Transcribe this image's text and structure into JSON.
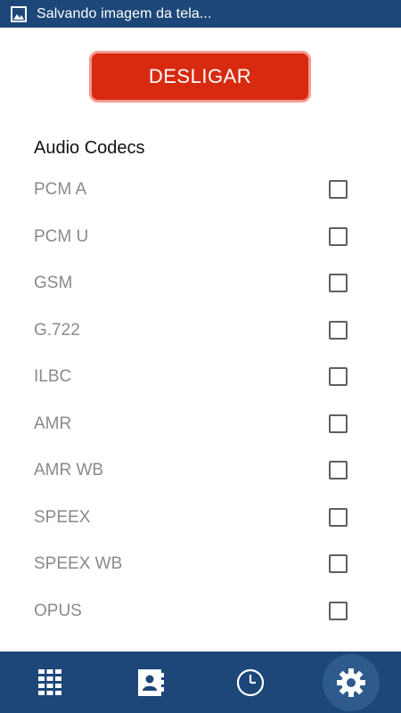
{
  "status_bar": {
    "notification_icon": "image-icon",
    "text": "Salvando imagem da tela..."
  },
  "disconnect_button": {
    "label": "DESLIGAR"
  },
  "audio_codecs": {
    "title": "Audio Codecs",
    "items": [
      {
        "label": "PCM A",
        "checked": false
      },
      {
        "label": "PCM U",
        "checked": false
      },
      {
        "label": "GSM",
        "checked": false
      },
      {
        "label": "G.722",
        "checked": false
      },
      {
        "label": "ILBC",
        "checked": false
      },
      {
        "label": "AMR",
        "checked": false
      },
      {
        "label": "AMR WB",
        "checked": false
      },
      {
        "label": "SPEEX",
        "checked": false
      },
      {
        "label": "SPEEX WB",
        "checked": false
      },
      {
        "label": "OPUS",
        "checked": false
      }
    ]
  },
  "bottom_nav": {
    "items": [
      {
        "icon": "dialpad-icon",
        "active": false
      },
      {
        "icon": "contacts-icon",
        "active": false
      },
      {
        "icon": "history-icon",
        "active": false
      },
      {
        "icon": "settings-icon",
        "active": true
      }
    ]
  },
  "colors": {
    "primary": "#1d4778",
    "danger": "#d82a10",
    "text_muted": "#8a8a8a"
  }
}
